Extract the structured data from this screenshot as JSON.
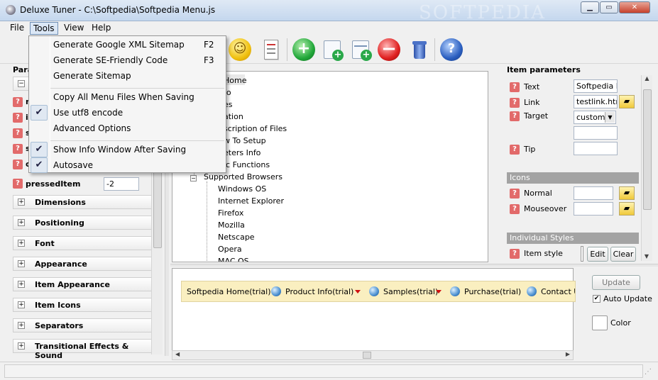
{
  "window": {
    "title": "Deluxe Tuner - C:\\Softpedia\\Softpedia Menu.js",
    "minimize_icon": "minimize-icon",
    "maximize_icon": "maximize-icon",
    "close_icon": "close-icon",
    "watermark": "SOFTPEDIA"
  },
  "menubar": {
    "file": "File",
    "tools": "Tools",
    "view": "View",
    "help": "Help"
  },
  "tools_menu": {
    "items": [
      {
        "label": "Generate Google XML Sitemap",
        "shortcut": "F2"
      },
      {
        "label": "Generate SE-Friendly Code",
        "shortcut": "F3"
      },
      {
        "label": "Generate Sitemap",
        "shortcut": ""
      },
      {
        "label": "Copy All Menu Files When Saving",
        "shortcut": ""
      },
      {
        "label": "Use utf8 encode",
        "shortcut": ""
      },
      {
        "label": "Advanced Options",
        "shortcut": ""
      },
      {
        "label": "Show Info Window After Saving",
        "shortcut": ""
      },
      {
        "label": "Autosave",
        "shortcut": ""
      }
    ],
    "checked": [
      "Use utf8 encode",
      "Show Info Window After Saving",
      "Autosave"
    ]
  },
  "toolbar": {
    "icons": [
      "smiley-icon",
      "list-icon",
      "add-item-icon",
      "add-page-icon",
      "add-subpage-icon",
      "delete-icon",
      "trash-icon",
      "help-icon"
    ]
  },
  "left_panel": {
    "header": "Para",
    "prop_partial_letters": [
      "n",
      "i",
      "s",
      "s",
      "o"
    ],
    "pressed_item_label": "pressedItem",
    "pressed_item_value": "-2",
    "groups": [
      "Dimensions",
      "Positioning",
      "Font",
      "Appearance",
      "Item Appearance",
      "Item Icons",
      "Separators",
      "Transitional Effects & Sound"
    ]
  },
  "tree": {
    "nodes": [
      {
        "label": "Home",
        "level": 1
      },
      {
        "label": "fo",
        "level": 1
      },
      {
        "label": "es",
        "level": 1
      },
      {
        "label": "ation",
        "level": 1
      },
      {
        "label": "scription of Files",
        "level": 1
      },
      {
        "label": "w To Setup",
        "level": 1
      },
      {
        "label": "eters Info",
        "level": 1
      },
      {
        "label": "ic Functions",
        "level": 1
      },
      {
        "label": "Supported Browsers",
        "level": 1
      },
      {
        "label": "Windows OS",
        "level": 2
      },
      {
        "label": "Internet Explorer",
        "level": 2
      },
      {
        "label": "Firefox",
        "level": 2
      },
      {
        "label": "Mozilla",
        "level": 2
      },
      {
        "label": "Netscape",
        "level": 2
      },
      {
        "label": "Opera",
        "level": 2
      },
      {
        "label": "MAC OS",
        "level": 2
      }
    ]
  },
  "item_parameters": {
    "title": "Item parameters",
    "text_label": "Text",
    "text_value": "Softpedia Ho",
    "link_label": "Link",
    "link_value": "testlink.htm",
    "target_label": "Target",
    "target_value": "custom",
    "tip_label": "Tip",
    "tip_value": "",
    "icons_section": "Icons",
    "normal_label": "Normal",
    "mouseover_label": "Mouseover",
    "styles_section": "Individual Styles",
    "item_style_label": "Item style",
    "edit_button": "Edit",
    "clear_button": "Clear"
  },
  "preview": {
    "items": [
      {
        "label": "Softpedia Home(trial)",
        "arrow": false
      },
      {
        "label": "Product Info(trial)",
        "arrow": true
      },
      {
        "label": "Samples(trial)",
        "arrow": true
      },
      {
        "label": "Purchase(trial)",
        "arrow": false
      },
      {
        "label": "Contact U",
        "arrow": false
      }
    ],
    "update_button": "Update",
    "auto_update_label": "Auto Update",
    "auto_update_checked": true,
    "color_label": "Color"
  }
}
